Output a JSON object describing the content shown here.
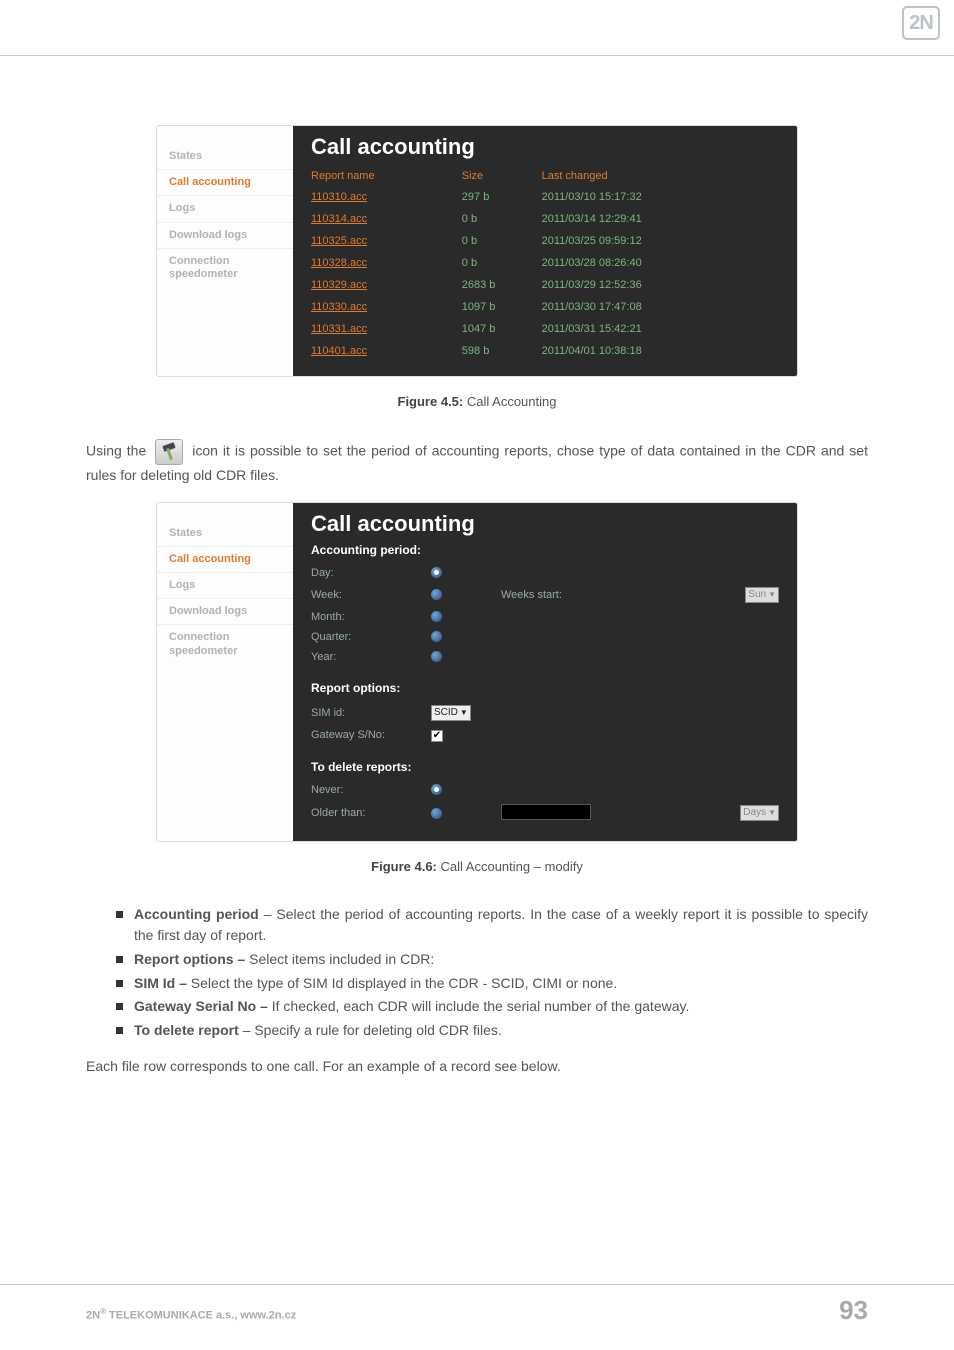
{
  "logo_text": "2N",
  "sidebar": {
    "items": [
      "States",
      "Call accounting",
      "Logs",
      "Download logs",
      "Connection speedometer"
    ],
    "active_index": 1
  },
  "panel1": {
    "title": "Call accounting",
    "columns": [
      "Report name",
      "Size",
      "Last changed"
    ],
    "rows": [
      {
        "name": "110310.acc",
        "size": "297 b",
        "changed": "2011/03/10 15:17:32"
      },
      {
        "name": "110314.acc",
        "size": "0 b",
        "changed": "2011/03/14 12:29:41"
      },
      {
        "name": "110325.acc",
        "size": "0 b",
        "changed": "2011/03/25 09:59:12"
      },
      {
        "name": "110328.acc",
        "size": "0 b",
        "changed": "2011/03/28 08:26:40"
      },
      {
        "name": "110329.acc",
        "size": "2683 b",
        "changed": "2011/03/29 12:52:36"
      },
      {
        "name": "110330.acc",
        "size": "1097 b",
        "changed": "2011/03/30 17:47:08"
      },
      {
        "name": "110331.acc",
        "size": "1047 b",
        "changed": "2011/03/31 15:42:21"
      },
      {
        "name": "110401.acc",
        "size": "598 b",
        "changed": "2011/04/01 10:38:18"
      }
    ]
  },
  "fig1": {
    "label": "Figure 4.5:",
    "caption": " Call Accounting"
  },
  "para1_a": "Using the ",
  "para1_b": " icon it is possible to set the period of accounting reports, chose type of data contained in the CDR and set rules for deleting old CDR files.",
  "panel2": {
    "title": "Call accounting",
    "section_period": "Accounting period:",
    "period": {
      "day": "Day:",
      "week": "Week:",
      "month": "Month:",
      "quarter": "Quarter:",
      "year": "Year:",
      "weeks_start": "Weeks start:",
      "weeks_start_value": "Sun"
    },
    "section_report": "Report options:",
    "report": {
      "sim_id": "SIM id:",
      "sim_id_value": "SCID",
      "gateway_sno": "Gateway S/No:",
      "gateway_checked": true
    },
    "section_delete": "To delete reports:",
    "del": {
      "never": "Never:",
      "older_than": "Older than:",
      "older_unit": "Days"
    }
  },
  "fig2": {
    "label": "Figure 4.6:",
    "caption": " Call Accounting – modify"
  },
  "bullets": [
    {
      "b": "Accounting period",
      "t": " – Select the period of accounting reports. In the case of a weekly report it is possible to specify the first day of report."
    },
    {
      "b": "Report options –",
      "t": " Select items included in CDR:"
    },
    {
      "b": "SIM Id –",
      "t": " Select the type of SIM Id displayed in the CDR - SCID, CIMI or none."
    },
    {
      "b": "Gateway Serial No –",
      "t": " If checked, each CDR will include the serial number of the gateway."
    },
    {
      "b": "To delete report",
      "t": " – Specify a rule for deleting old CDR files."
    }
  ],
  "para2": "Each file row corresponds to one call. For an example of a record see below.",
  "footer": {
    "left": "2N® TELEKOMUNIKACE a.s., www.2n.cz",
    "page": "93"
  }
}
